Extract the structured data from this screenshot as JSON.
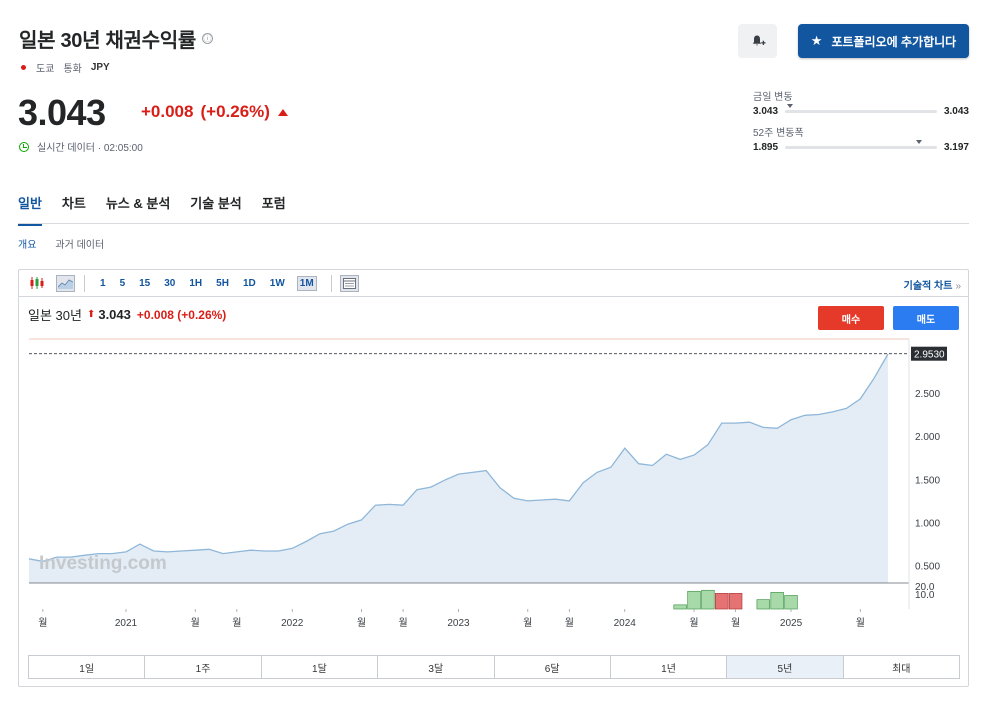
{
  "header": {
    "title": "일본 30년 채권수익률",
    "info_icon": "ⓘ",
    "exchange": "도쿄",
    "currency_label": "통화",
    "currency": "JPY",
    "price": "3.043",
    "change": "+0.008",
    "change_pct": "(+0.26%)",
    "realtime": "실시간 데이터 · 02:05:00",
    "portfolio_button": "포트폴리오에 추가합니다"
  },
  "day_range": {
    "label": "금일 변동",
    "low": "3.043",
    "high": "3.043",
    "marker_fraction": 0.01
  },
  "week52_range": {
    "label": "52주 변동폭",
    "low": "1.895",
    "high": "3.197",
    "marker_fraction": 0.88
  },
  "tabs": [
    "일반",
    "차트",
    "뉴스 & 분석",
    "기술 분석",
    "포럼"
  ],
  "subtabs": [
    "개요",
    "과거 데이터"
  ],
  "toolbar": {
    "intervals": [
      "1",
      "5",
      "15",
      "30",
      "1H",
      "5H",
      "1D",
      "1W",
      "1M"
    ],
    "active_interval": "1M",
    "tech_chart_link": "기술적 차트",
    "tech_chart_arrow": "»"
  },
  "legend": {
    "name": "일본 30년",
    "arrow": "⬆",
    "price": "3.043",
    "change": "+0.008 (+0.26%)"
  },
  "buttons": {
    "buy": "매수",
    "sell": "매도"
  },
  "periods": [
    "1일",
    "1주",
    "1달",
    "3달",
    "6달",
    "1년",
    "5년",
    "최대"
  ],
  "active_period": "5년",
  "colors": {
    "accent": "#1256a0",
    "down_red": "#d91e18",
    "line": "#8fb7d9",
    "area": "#e4edf5",
    "vol_up": "#a7d9a9",
    "vol_down": "#e57373",
    "buy": "#e53a2a",
    "sell": "#2a7cf0"
  },
  "chart_data": {
    "type": "area",
    "watermark": "Investing.com",
    "ylim": [
      0.3,
      3.1
    ],
    "y_ticks": [
      "0.500",
      "1.000",
      "1.500",
      "2.000",
      "2.500"
    ],
    "y_tick_values": [
      0.5,
      1.0,
      1.5,
      2.0,
      2.5
    ],
    "price_label": "2.9530",
    "price_label_value": 2.953,
    "vol_ticks": [
      "20.0",
      "10.0"
    ],
    "x_labels": [
      "월",
      "2021",
      "월",
      "월",
      "2022",
      "월",
      "월",
      "2023",
      "월",
      "월",
      "2024",
      "월",
      "월",
      "2025",
      "월"
    ],
    "x_label_index": [
      1,
      7,
      12,
      15,
      19,
      24,
      27,
      31,
      36,
      39,
      43,
      48,
      51,
      55,
      60
    ],
    "values": [
      0.58,
      0.55,
      0.6,
      0.6,
      0.62,
      0.64,
      0.64,
      0.66,
      0.75,
      0.67,
      0.66,
      0.67,
      0.68,
      0.69,
      0.64,
      0.66,
      0.68,
      0.67,
      0.67,
      0.7,
      0.78,
      0.87,
      0.9,
      0.98,
      1.03,
      1.2,
      1.21,
      1.2,
      1.38,
      1.41,
      1.49,
      1.56,
      1.58,
      1.6,
      1.4,
      1.28,
      1.25,
      1.26,
      1.27,
      1.25,
      1.46,
      1.58,
      1.64,
      1.86,
      1.68,
      1.66,
      1.79,
      1.73,
      1.78,
      1.9,
      2.15,
      2.15,
      2.16,
      2.1,
      2.09,
      2.19,
      2.24,
      2.25,
      2.28,
      2.32,
      2.43,
      2.67,
      2.95
    ],
    "volume": [
      {
        "index": 47,
        "value": 4,
        "dir": "up"
      },
      {
        "index": 48,
        "value": 17,
        "dir": "up"
      },
      {
        "index": 49,
        "value": 18,
        "dir": "up"
      },
      {
        "index": 50,
        "value": 15,
        "dir": "down"
      },
      {
        "index": 51,
        "value": 15,
        "dir": "down"
      },
      {
        "index": 53,
        "value": 9,
        "dir": "up"
      },
      {
        "index": 54,
        "value": 16,
        "dir": "up"
      },
      {
        "index": 55,
        "value": 13,
        "dir": "up"
      }
    ],
    "vol_max": 25
  }
}
